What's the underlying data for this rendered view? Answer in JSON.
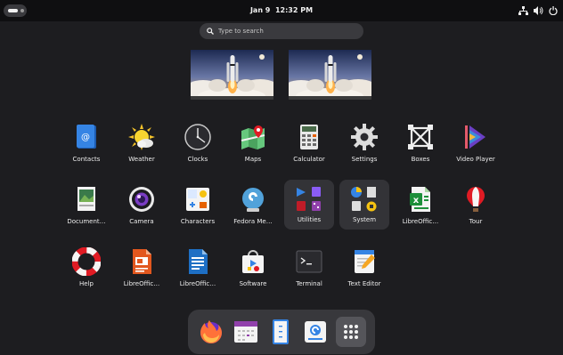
{
  "topbar": {
    "date": "Jan 9",
    "time": "12:32 PM",
    "activities_icon": "activities-indicator-icon",
    "system_icons": [
      "network-wired-icon",
      "speaker-volume-icon",
      "power-icon"
    ]
  },
  "search": {
    "placeholder": "Type to search",
    "value": "",
    "icon": "search-icon"
  },
  "workspaces": [
    {
      "wallpaper": "rocket-launch-wallpaper"
    },
    {
      "wallpaper": "rocket-launch-wallpaper"
    }
  ],
  "apps": [
    {
      "label": "Contacts",
      "icon": "contacts-icon"
    },
    {
      "label": "Weather",
      "icon": "weather-icon"
    },
    {
      "label": "Clocks",
      "icon": "clock-icon"
    },
    {
      "label": "Maps",
      "icon": "maps-icon"
    },
    {
      "label": "Calculator",
      "icon": "calculator-icon"
    },
    {
      "label": "Settings",
      "icon": "settings-gear-icon"
    },
    {
      "label": "Boxes",
      "icon": "boxes-icon"
    },
    {
      "label": "Video Player",
      "icon": "video-player-icon"
    },
    {
      "label": "Document…",
      "icon": "document-viewer-icon"
    },
    {
      "label": "Camera",
      "icon": "camera-icon"
    },
    {
      "label": "Characters",
      "icon": "characters-icon"
    },
    {
      "label": "Fedora Me…",
      "icon": "fedora-media-writer-icon"
    },
    {
      "label": "Utilities",
      "icon": "utilities-folder-icon"
    },
    {
      "label": "System",
      "icon": "system-folder-icon"
    },
    {
      "label": "LibreOffic…",
      "icon": "libreoffice-calc-icon"
    },
    {
      "label": "Tour",
      "icon": "tour-balloon-icon"
    },
    {
      "label": "Help",
      "icon": "help-lifebuoy-icon"
    },
    {
      "label": "LibreOffic…",
      "icon": "libreoffice-impress-icon"
    },
    {
      "label": "LibreOffic…",
      "icon": "libreoffice-writer-icon"
    },
    {
      "label": "Software",
      "icon": "software-store-icon"
    },
    {
      "label": "Terminal",
      "icon": "terminal-icon"
    },
    {
      "label": "Text Editor",
      "icon": "text-editor-icon"
    }
  ],
  "dock": [
    {
      "name": "firefox",
      "icon": "firefox-icon"
    },
    {
      "name": "calendar",
      "icon": "calendar-icon"
    },
    {
      "name": "files",
      "icon": "files-icon"
    },
    {
      "name": "software",
      "icon": "software-installer-icon"
    },
    {
      "name": "show-apps",
      "icon": "app-grid-icon"
    }
  ]
}
